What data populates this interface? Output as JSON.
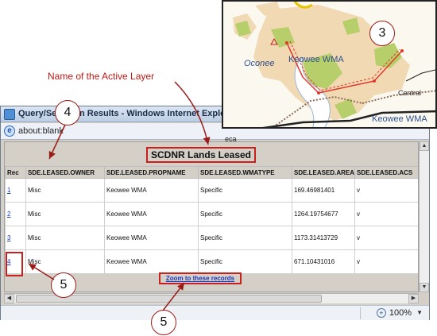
{
  "window": {
    "title": "Query/Selection Results - Windows Internet Explorer",
    "address": "about:blank",
    "zoom_level": "100%"
  },
  "layer": {
    "title": "SCDNR Lands Leased"
  },
  "table": {
    "columns": [
      "Rec",
      "SDE.LEASED.OWNER",
      "SDE.LEASED.PROPNAME",
      "SDE.LEASED.WMATYPE",
      "SDE.LEASED.AREA",
      "SDE.LEASED.ACS"
    ],
    "rows": [
      {
        "rec": "1",
        "owner": "Misc",
        "propname": "Keowee WMA",
        "wmatype": "Specific",
        "area": "169.46981401",
        "acs": "v"
      },
      {
        "rec": "2",
        "owner": "Misc",
        "propname": "Keowee WMA",
        "wmatype": "Specific",
        "area": "1264.19754677",
        "acs": "v"
      },
      {
        "rec": "3",
        "owner": "Misc",
        "propname": "Keowee WMA",
        "wmatype": "Specific",
        "area": "1173.31413729",
        "acs": "v"
      },
      {
        "rec": "4",
        "owner": "Misc",
        "propname": "Keowee WMA",
        "wmatype": "Specific",
        "area": "671.10431016",
        "acs": "v"
      }
    ],
    "zoom_link": "Zoom to these records"
  },
  "map": {
    "labels": {
      "oconee": "Oconee",
      "keowee_wma_1": "Keowee WMA",
      "keowee_wma_2": "Keowee WMA",
      "central": "Central",
      "eca": "eca"
    },
    "colors": {
      "land": "#f1d9b4",
      "wma": "#b7cf6a",
      "selection": "#e0392b"
    }
  },
  "annotations": {
    "active_layer": "Name of the Active Layer",
    "callout_3": "3",
    "callout_4": "4",
    "callout_5a": "5",
    "callout_5b": "5"
  },
  "icons": {
    "title": "ie-window-icon",
    "address": "ie-page-icon",
    "zoom": "magnifier-icon"
  }
}
